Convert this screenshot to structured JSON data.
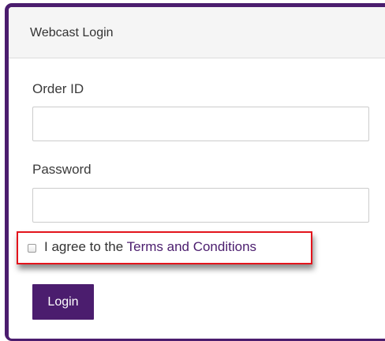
{
  "panel": {
    "title": "Webcast Login"
  },
  "form": {
    "order_id_label": "Order ID",
    "order_id_value": "",
    "password_label": "Password",
    "password_value": "",
    "agree_prefix": "I agree to the",
    "terms_link_text": "Terms and Conditions",
    "terms_checked": false,
    "login_label": "Login"
  },
  "colors": {
    "frame": "#4b1d6e",
    "button": "#4b1d6e",
    "link": "#4b1d6e",
    "highlight_border": "#e3141c",
    "header_bg": "#f5f5f5"
  }
}
